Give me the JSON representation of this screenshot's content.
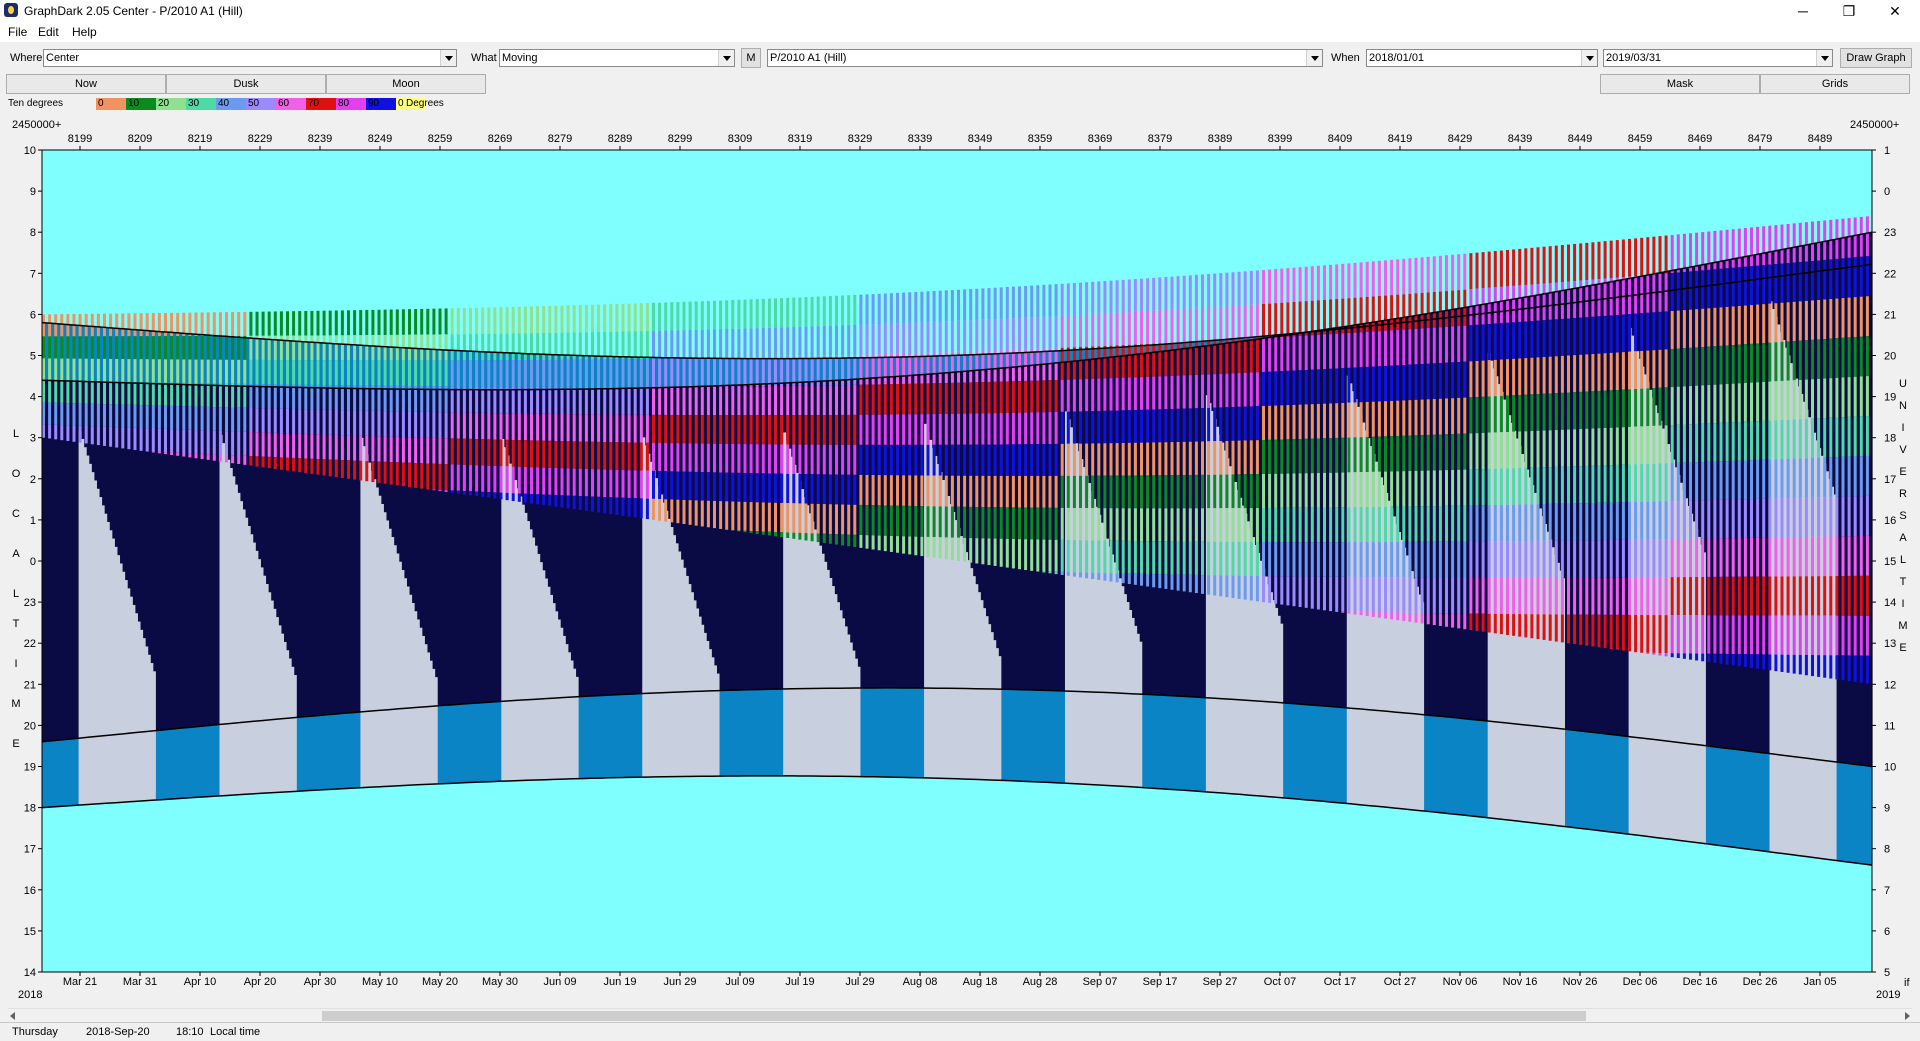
{
  "window": {
    "title": "GraphDark 2.05  Center  -  P/2010 A1 (Hill)",
    "minimize": "─",
    "maximize": "❐",
    "close": "✕"
  },
  "menu": {
    "file": "File",
    "edit": "Edit",
    "help": "Help"
  },
  "toolbar": {
    "where_label": "Where",
    "where_value": "Center",
    "what_label": "What",
    "what_value": "Moving",
    "m_button": "M",
    "object_value": "P/2010 A1 (Hill)",
    "when_label": "When",
    "start_date": "2018/01/01",
    "end_date": "2019/03/31",
    "draw_button": "Draw Graph"
  },
  "buttons": {
    "now": "Now",
    "dusk": "Dusk",
    "moon": "Moon",
    "mask": "Mask",
    "grids": "Grids"
  },
  "legend": {
    "left_label": "Ten degrees",
    "right_label": "Degrees",
    "swatches": [
      {
        "text": "0",
        "color": "#f0935e"
      },
      {
        "text": "10",
        "color": "#0b8a20"
      },
      {
        "text": "20",
        "color": "#8fe08f"
      },
      {
        "text": "30",
        "color": "#4fd9a6"
      },
      {
        "text": "40",
        "color": "#6b9af0"
      },
      {
        "text": "50",
        "color": "#9b8aff"
      },
      {
        "text": "60",
        "color": "#f060e8"
      },
      {
        "text": "70",
        "color": "#e01010"
      },
      {
        "text": "80",
        "color": "#e040f0"
      },
      {
        "text": "90",
        "color": "#1010e0"
      },
      {
        "text": "0",
        "color": "#ffff80"
      }
    ]
  },
  "chart_data": {
    "type": "heatmap",
    "jd_prefix_left": "2450000+",
    "jd_prefix_right": "2450000+",
    "jd_ticks": [
      "8199",
      "8209",
      "8219",
      "8229",
      "8239",
      "8249",
      "8259",
      "8269",
      "8279",
      "8289",
      "8299",
      "8309",
      "8319",
      "8329",
      "8339",
      "8349",
      "8359",
      "8369",
      "8379",
      "8389",
      "8399",
      "8409",
      "8419",
      "8429",
      "8439",
      "8449",
      "8459",
      "8469",
      "8479",
      "8489"
    ],
    "date_ticks": [
      "Mar 21",
      "Mar 31",
      "Apr 10",
      "Apr 20",
      "Apr 30",
      "May 10",
      "May 20",
      "May 30",
      "Jun 09",
      "Jun 19",
      "Jun 29",
      "Jul 09",
      "Jul 19",
      "Jul 29",
      "Aug 08",
      "Aug 18",
      "Aug 28",
      "Sep 07",
      "Sep 17",
      "Sep 27",
      "Oct 07",
      "Oct 17",
      "Oct 27",
      "Nov 06",
      "Nov 16",
      "Nov 26",
      "Dec 06",
      "Dec 16",
      "Dec 26",
      "Jan 05"
    ],
    "year_left": "2018",
    "year_right": "2019",
    "corner_right": "if",
    "left_axis_title": "LOCAL TIME",
    "right_axis_title": "UNIVERSAL TIME",
    "local_hours": [
      "10",
      "9",
      "8",
      "7",
      "6",
      "5",
      "4",
      "3",
      "2",
      "1",
      "0",
      "23",
      "22",
      "21",
      "20",
      "19",
      "18",
      "17",
      "16",
      "15",
      "14"
    ],
    "ut_hours": [
      "1",
      "0",
      "23",
      "22",
      "21",
      "20",
      "19",
      "18",
      "17",
      "16",
      "15",
      "14",
      "13",
      "12",
      "11",
      "10",
      "9",
      "8",
      "7",
      "6",
      "5"
    ],
    "colors": {
      "day": "#80ffff",
      "twilight": "#0a84c4",
      "night": "#0a0a44",
      "moon_night": "#c8d0e0"
    }
  },
  "status": {
    "day": "Thursday",
    "date": "2018-Sep-20",
    "time": "18:10",
    "mode": "Local time"
  }
}
